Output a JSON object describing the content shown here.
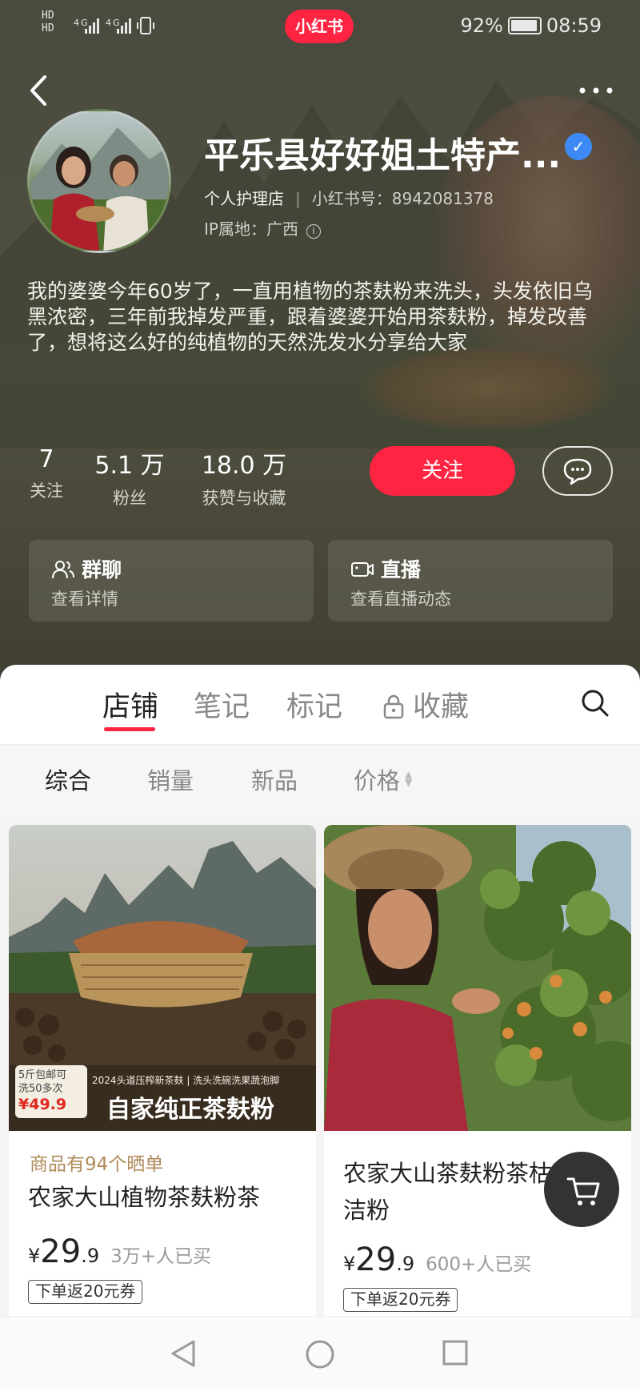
{
  "status_bar": {
    "left": "HD 4G 4G",
    "battery": "92%",
    "time": "08:59",
    "app_logo": "小红书"
  },
  "profile": {
    "shop_name": "平乐县好好姐土特产...",
    "shop_type": "个人护理店",
    "red_id_label": "小红书号：",
    "red_id": "8942081378",
    "ip_label": "IP属地：",
    "ip_location": "广西",
    "bio": "我的婆婆今年60岁了，一直用植物的茶麸粉来洗头，头发依旧乌黑浓密，三年前我掉发严重，跟着婆婆开始用茶麸粉，掉发改善了，想将这么好的纯植物的天然洗发水分享给大家"
  },
  "stats": [
    {
      "value": "7",
      "label": "关注"
    },
    {
      "value": "5.1 万",
      "label": "粉丝"
    },
    {
      "value": "18.0 万",
      "label": "获赞与收藏"
    }
  ],
  "buttons": {
    "follow": "关注"
  },
  "cards": [
    {
      "title": "群聊",
      "sub": "查看详情"
    },
    {
      "title": "直播",
      "sub": "查看直播动态"
    }
  ],
  "tabs": [
    "店铺",
    "笔记",
    "标记",
    "收藏"
  ],
  "filters": [
    "综合",
    "销量",
    "新品",
    "价格"
  ],
  "products": [
    {
      "image_badge_line1": "5斤包邮可",
      "image_badge_line2": "洗50多次",
      "image_price": "¥49.9",
      "image_banner_small": "2024头道压榨新茶麸 | 洗头洗碗洗果蔬泡脚",
      "image_banner": "自家纯正茶麸粉",
      "hint": "商品有94个晒单",
      "title": "农家大山植物茶麸粉茶",
      "currency": "¥",
      "price_int": "29",
      "price_dec": ".9",
      "sold": "3万+人已买",
      "coupon": "下单返20元券"
    },
    {
      "title": "农家大山茶麸粉茶枯粉洗洁粉",
      "currency": "¥",
      "price_int": "29",
      "price_dec": ".9",
      "sold": "600+人已买",
      "coupon": "下单返20元券"
    }
  ],
  "icons": {
    "back": "back-arrow-icon",
    "more": "more-dots-icon",
    "verified": "verified-badge-icon",
    "message": "chat-bubble-icon",
    "group": "group-users-icon",
    "live": "video-camera-icon",
    "lock": "lock-icon",
    "search": "search-icon",
    "cart": "cart-icon"
  },
  "colors": {
    "accent": "#ff2442",
    "verified": "#3d8af7",
    "hint": "#b08a5a"
  }
}
